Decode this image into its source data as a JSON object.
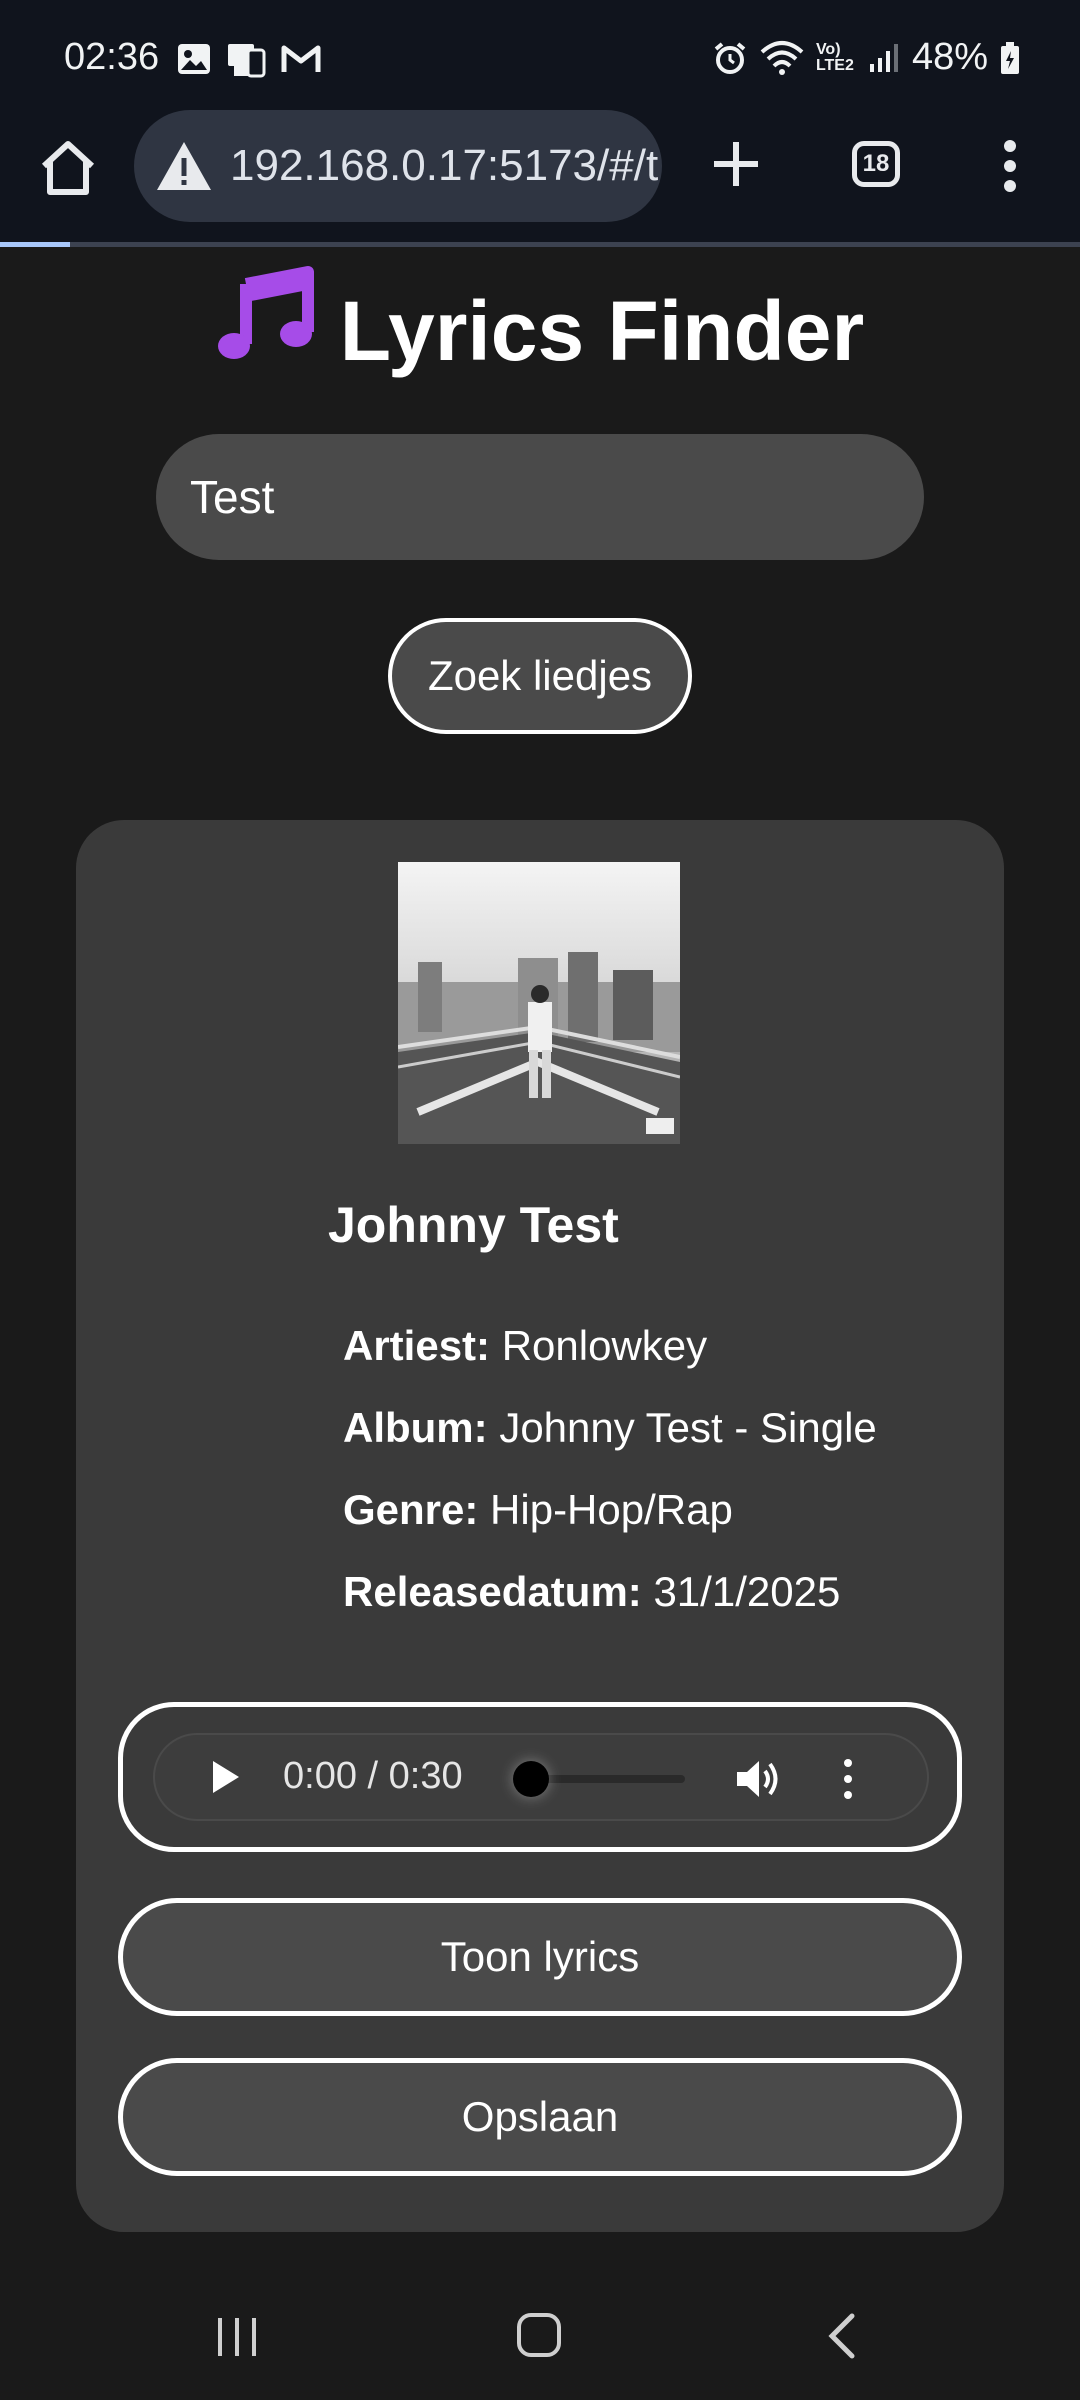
{
  "status_bar": {
    "time": "02:36",
    "notification_icons": [
      "image-icon",
      "phone-link-icon",
      "gmail-icon"
    ],
    "system_icons": [
      "alarm-icon",
      "wifi-icon",
      "volte-icon",
      "signal-icon"
    ],
    "volte_label": "Vo) LTE2",
    "battery": "48%"
  },
  "browser": {
    "url": "192.168.0.17:5173/#/t",
    "tab_count": "18",
    "load_progress": 0.065,
    "accent_color": "#a8c7fa"
  },
  "app": {
    "title": "Lyrics Finder",
    "title_icon": "music-note-icon",
    "search": {
      "value": "Test",
      "placeholder": ""
    },
    "search_button": "Zoek liedjes"
  },
  "result": {
    "song_title": "Johnny Test",
    "meta": [
      {
        "label": "Artiest:",
        "value": "Ronlowkey"
      },
      {
        "label": "Album:",
        "value": "Johnny Test - Single"
      },
      {
        "label": "Genre:",
        "value": "Hip-Hop/Rap"
      },
      {
        "label": "Releasedatum:",
        "value": "31/1/2025"
      }
    ],
    "audio": {
      "time": "0:00 / 0:30",
      "position": 0.0
    },
    "show_lyrics_button": "Toon lyrics",
    "save_button": "Opslaan"
  },
  "colors": {
    "background": "#1a1a1a",
    "card": "#3a3a3a",
    "button": "#4a4a4a",
    "music_note": "#a64ce8"
  }
}
